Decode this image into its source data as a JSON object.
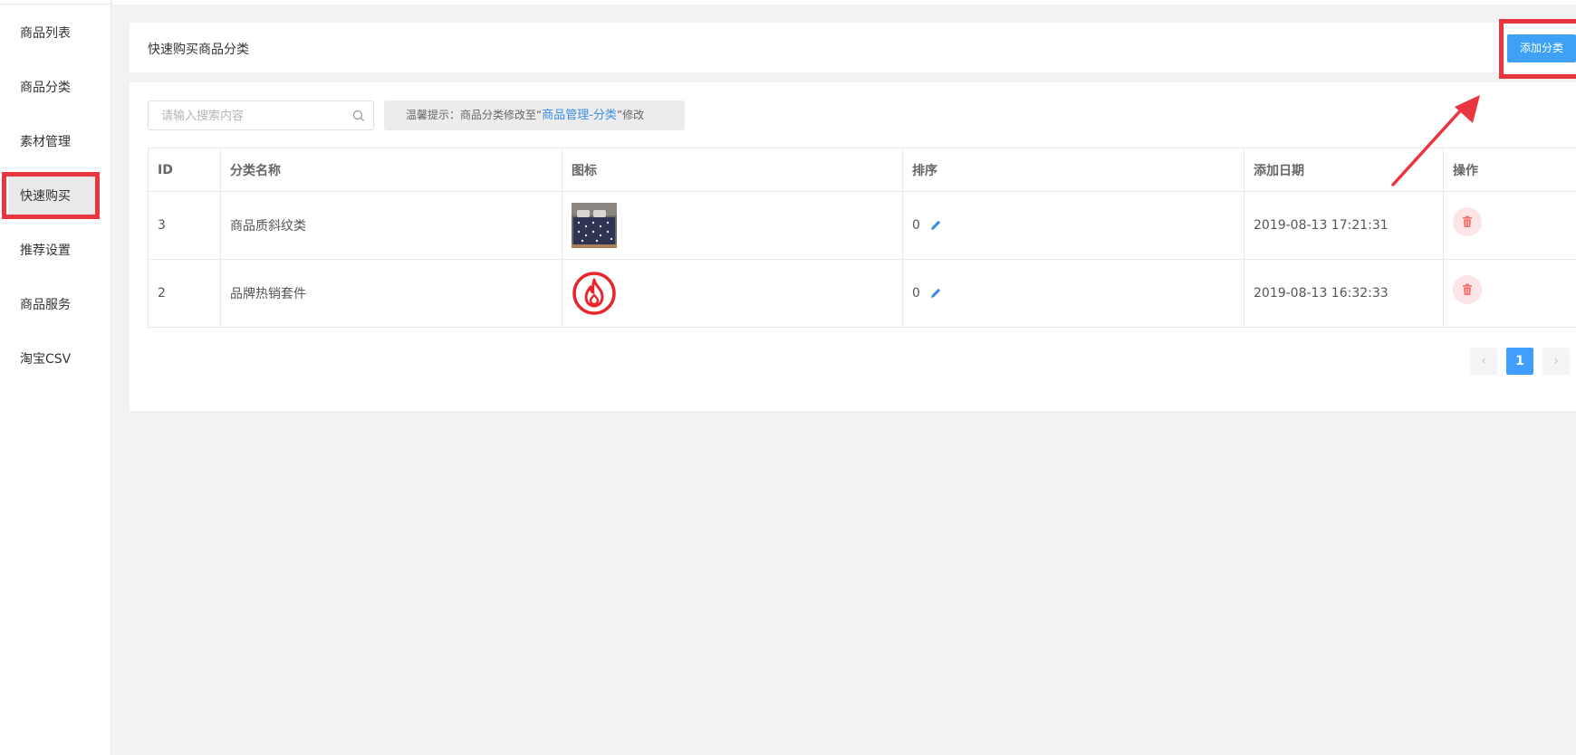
{
  "sidebar": {
    "items": [
      {
        "label": "商品列表"
      },
      {
        "label": "商品分类"
      },
      {
        "label": "素材管理"
      },
      {
        "label": "快速购买"
      },
      {
        "label": "推荐设置"
      },
      {
        "label": "商品服务"
      },
      {
        "label": "淘宝CSV"
      }
    ],
    "active_index": 3
  },
  "header": {
    "title": "快速购买商品分类",
    "add_button_label": "添加分类"
  },
  "search": {
    "placeholder": "请输入搜索内容",
    "value": ""
  },
  "tip": {
    "prefix": "温馨提示：商品分类修改至",
    "open_quote": "“",
    "link_text": "商品管理-分类",
    "close_quote": "”",
    "suffix": "修改"
  },
  "table": {
    "columns": [
      "ID",
      "分类名称",
      "图标",
      "排序",
      "添加日期",
      "操作"
    ],
    "rows": [
      {
        "id": "3",
        "name": "商品质斜纹类",
        "icon": "bedding-photo",
        "sort": "0",
        "date": "2019-08-13 17:21:31"
      },
      {
        "id": "2",
        "name": "品牌热销套件",
        "icon": "fire-icon",
        "sort": "0",
        "date": "2019-08-13 16:32:33"
      }
    ]
  },
  "pagination": {
    "prev": "‹",
    "current": "1",
    "next": "›"
  },
  "colors": {
    "primary": "#3ea1f5",
    "highlight": "#e8353e",
    "delete": "#f56c6c",
    "link": "#3a8ee6"
  }
}
